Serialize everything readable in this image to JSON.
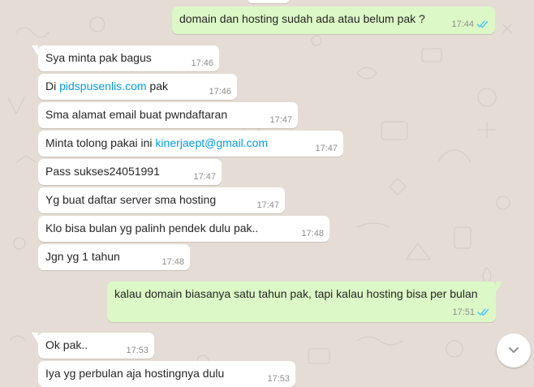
{
  "colors": {
    "background": "#e5ddd5",
    "incoming_bubble": "#ffffff",
    "outgoing_bubble": "#dcf8c6",
    "link": "#039be5",
    "read_ticks": "#4fc3f7",
    "time": "#8d8d8d"
  },
  "messages": [
    {
      "direction": "out",
      "text": "domain dan hosting sudah ada atau belum pak ?",
      "time": "17:44",
      "status": "read"
    },
    {
      "direction": "in",
      "text": "Sya minta pak bagus",
      "time": "17:46"
    },
    {
      "direction": "in",
      "prefix": "Di ",
      "link": "pidspusenlis.com",
      "suffix": " pak",
      "time": "17:46"
    },
    {
      "direction": "in",
      "text": "Sma alamat email buat pwndaftaran",
      "time": "17:47"
    },
    {
      "direction": "in",
      "prefix": "Minta tolong pakai ini ",
      "link": "kinerjaept@gmail.com",
      "time": "17:47"
    },
    {
      "direction": "in",
      "text": "Pass sukses24051991",
      "time": "17:47"
    },
    {
      "direction": "in",
      "text": "Yg buat daftar server sma hosting",
      "time": "17:47"
    },
    {
      "direction": "in",
      "text": "Klo bisa bulan yg palinh pendek dulu pak..",
      "time": "17:48"
    },
    {
      "direction": "in",
      "text": "Jgn yg 1 tahun",
      "time": "17:48"
    },
    {
      "direction": "out",
      "text": "kalau domain biasanya satu tahun pak, tapi kalau hosting bisa per bulan",
      "time": "17:51",
      "status": "read"
    },
    {
      "direction": "in",
      "text": "Ok pak..",
      "time": "17:53"
    },
    {
      "direction": "in",
      "text": "Iya yg perbulan aja hostingnya dulu",
      "time": "17:53"
    }
  ],
  "controls": {
    "scroll_down_icon": "chevron-down-icon"
  }
}
